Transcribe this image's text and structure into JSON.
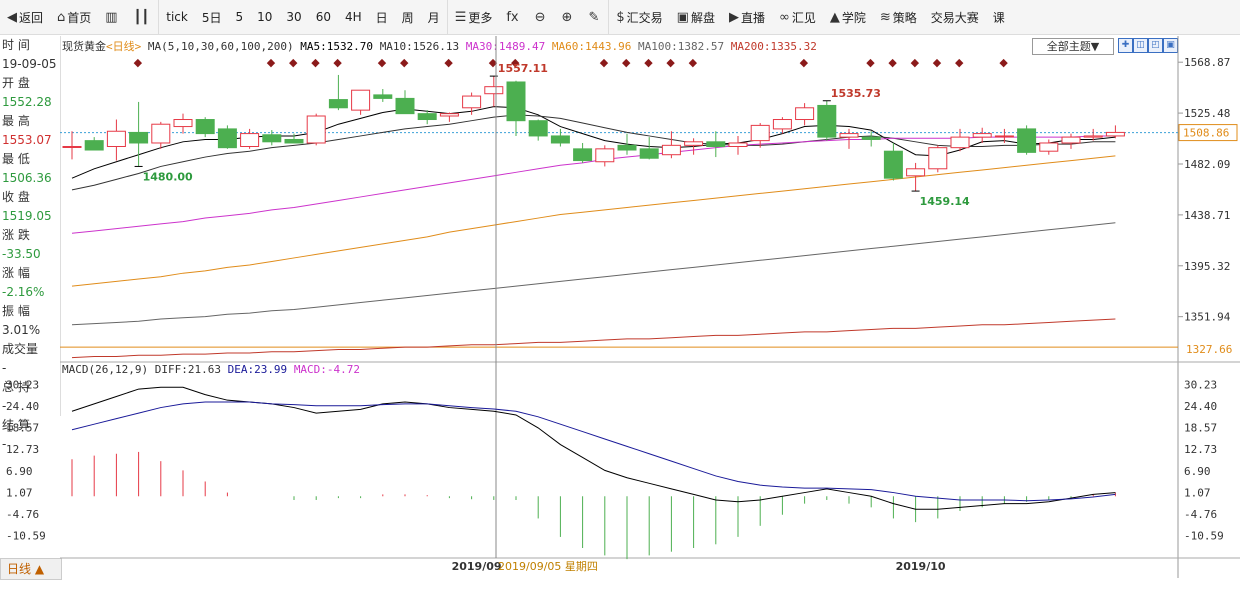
{
  "toolbar": {
    "items": [
      {
        "name": "back",
        "icon": "back-arrow-icon",
        "glyph": "◀",
        "label": "返回"
      },
      {
        "name": "home",
        "icon": "home-icon",
        "glyph": "⌂",
        "label": "首页"
      },
      {
        "name": "chart-type",
        "icon": "bar-chart-icon",
        "glyph": "▥",
        "label": ""
      },
      {
        "name": "candle",
        "icon": "candle-icon",
        "glyph": "┃┃",
        "label": ""
      },
      {
        "name": "tick",
        "icon": "",
        "glyph": "",
        "label": "tick"
      },
      {
        "name": "5day",
        "icon": "",
        "glyph": "",
        "label": "5日"
      },
      {
        "name": "p5",
        "icon": "",
        "glyph": "",
        "label": "5"
      },
      {
        "name": "p10",
        "icon": "",
        "glyph": "",
        "label": "10"
      },
      {
        "name": "p30",
        "icon": "",
        "glyph": "",
        "label": "30"
      },
      {
        "name": "p60",
        "icon": "",
        "glyph": "",
        "label": "60"
      },
      {
        "name": "p4h",
        "icon": "",
        "glyph": "",
        "label": "4H"
      },
      {
        "name": "day",
        "icon": "",
        "glyph": "",
        "label": "日"
      },
      {
        "name": "week",
        "icon": "",
        "glyph": "",
        "label": "周"
      },
      {
        "name": "month",
        "icon": "",
        "glyph": "",
        "label": "月"
      },
      {
        "name": "more",
        "icon": "list-icon",
        "glyph": "☰",
        "label": "更多"
      },
      {
        "name": "fx",
        "icon": "fx-icon",
        "glyph": "fx",
        "label": ""
      },
      {
        "name": "zoom-out",
        "icon": "zoom-out-icon",
        "glyph": "⊖",
        "label": ""
      },
      {
        "name": "zoom-in",
        "icon": "zoom-in-icon",
        "glyph": "⊕",
        "label": ""
      },
      {
        "name": "draw",
        "icon": "pen-icon",
        "glyph": "✎",
        "label": ""
      },
      {
        "name": "trade",
        "icon": "dollar-icon",
        "glyph": "$",
        "label": "汇交易"
      },
      {
        "name": "analysis",
        "icon": "chat-icon",
        "glyph": "▣",
        "label": "解盘"
      },
      {
        "name": "live",
        "icon": "play-icon",
        "glyph": "▶",
        "label": "直播"
      },
      {
        "name": "huijian",
        "icon": "link-icon",
        "glyph": "∞",
        "label": "汇见"
      },
      {
        "name": "academy",
        "icon": "graduation-cap-icon",
        "glyph": "▲",
        "label": "学院"
      },
      {
        "name": "strategy",
        "icon": "layers-icon",
        "glyph": "≋",
        "label": "策略"
      },
      {
        "name": "contest",
        "icon": "",
        "glyph": "",
        "label": "交易大赛"
      },
      {
        "name": "course",
        "icon": "",
        "glyph": "",
        "label": "课"
      }
    ]
  },
  "sidebar": {
    "rows": [
      {
        "label": "时 间",
        "cls": ""
      },
      {
        "label": "19-09-05",
        "cls": ""
      },
      {
        "label": "开 盘",
        "cls": ""
      },
      {
        "label": "1552.28",
        "cls": "sb-green"
      },
      {
        "label": "最 高",
        "cls": ""
      },
      {
        "label": "1553.07",
        "cls": "sb-red"
      },
      {
        "label": "最 低",
        "cls": ""
      },
      {
        "label": "1506.36",
        "cls": "sb-green"
      },
      {
        "label": "收 盘",
        "cls": ""
      },
      {
        "label": "1519.05",
        "cls": "sb-green"
      },
      {
        "label": "涨 跌",
        "cls": ""
      },
      {
        "label": "-33.50",
        "cls": "sb-green"
      },
      {
        "label": "涨 幅",
        "cls": ""
      },
      {
        "label": "-2.16%",
        "cls": "sb-green"
      },
      {
        "label": "振 幅",
        "cls": ""
      },
      {
        "label": "3.01%",
        "cls": ""
      },
      {
        "label": "成交量",
        "cls": ""
      },
      {
        "label": "-",
        "cls": ""
      },
      {
        "label": "总 持",
        "cls": ""
      },
      {
        "label": "-",
        "cls": ""
      },
      {
        "label": "结 算",
        "cls": ""
      },
      {
        "label": "-",
        "cls": ""
      }
    ],
    "bottom_tab": "日线 ▲"
  },
  "legend": {
    "instrument": "现货黄金",
    "period": "<日线>",
    "ma_spec": "MA(5,10,30,60,100,200)",
    "ma5": "MA5:1532.70",
    "ma10": "MA10:1526.13",
    "ma30": "MA30:1489.47",
    "ma60": "MA60:1443.96",
    "ma100": "MA100:1382.57",
    "ma200": "MA200:1335.32",
    "theme_button": "全部主题▼"
  },
  "macd_legend": {
    "spec": "MACD(26,12,9)",
    "diff": "DIFF:21.63",
    "dea": "DEA:23.99",
    "macd": "MACD:-4.72"
  },
  "colors": {
    "up": "#e63946",
    "down": "#4caf50",
    "ma5": "#000000",
    "ma10": "#333333",
    "ma30": "#cc33cc",
    "ma60": "#e08c1a",
    "ma100": "#666666",
    "ma200": "#c0392b",
    "diff": "#000000",
    "dea": "#1a1a99"
  },
  "chart_data": [
    {
      "type": "candlestick",
      "title": "现货黄金<日线>",
      "ylim": [
        1315,
        1575
      ],
      "yticks": [
        1568.87,
        1525.48,
        1482.09,
        1438.71,
        1395.32,
        1351.94
      ],
      "current_price_label": "1508.86",
      "bottom_price_label": "1327.66",
      "candles": [
        {
          "o": 1497,
          "h": 1510,
          "l": 1486,
          "c": 1497
        },
        {
          "o": 1502,
          "h": 1505,
          "l": 1495,
          "c": 1494
        },
        {
          "o": 1497,
          "h": 1520,
          "l": 1485,
          "c": 1510
        },
        {
          "o": 1509,
          "h": 1535,
          "l": 1480,
          "c": 1500
        },
        {
          "o": 1500,
          "h": 1518,
          "l": 1495,
          "c": 1516
        },
        {
          "o": 1514,
          "h": 1525,
          "l": 1508,
          "c": 1520
        },
        {
          "o": 1520,
          "h": 1522,
          "l": 1505,
          "c": 1508
        },
        {
          "o": 1512,
          "h": 1515,
          "l": 1495,
          "c": 1496
        },
        {
          "o": 1497,
          "h": 1512,
          "l": 1495,
          "c": 1508
        },
        {
          "o": 1507,
          "h": 1511,
          "l": 1498,
          "c": 1501
        },
        {
          "o": 1503,
          "h": 1508,
          "l": 1500,
          "c": 1500
        },
        {
          "o": 1500,
          "h": 1525,
          "l": 1498,
          "c": 1523
        },
        {
          "o": 1537,
          "h": 1558,
          "l": 1528,
          "c": 1530
        },
        {
          "o": 1528,
          "h": 1545,
          "l": 1524,
          "c": 1545
        },
        {
          "o": 1541,
          "h": 1546,
          "l": 1535,
          "c": 1538
        },
        {
          "o": 1538,
          "h": 1545,
          "l": 1525,
          "c": 1525
        },
        {
          "o": 1525,
          "h": 1528,
          "l": 1516,
          "c": 1520
        },
        {
          "o": 1523,
          "h": 1526,
          "l": 1518,
          "c": 1525
        },
        {
          "o": 1530,
          "h": 1543,
          "l": 1524,
          "c": 1540
        },
        {
          "o": 1542,
          "h": 1557,
          "l": 1531,
          "c": 1548
        },
        {
          "o": 1552,
          "h": 1553,
          "l": 1506,
          "c": 1519
        },
        {
          "o": 1519,
          "h": 1520,
          "l": 1502,
          "c": 1506
        },
        {
          "o": 1506,
          "h": 1512,
          "l": 1497,
          "c": 1500
        },
        {
          "o": 1495,
          "h": 1500,
          "l": 1483,
          "c": 1485
        },
        {
          "o": 1484,
          "h": 1498,
          "l": 1480,
          "c": 1495
        },
        {
          "o": 1498,
          "h": 1508,
          "l": 1490,
          "c": 1494
        },
        {
          "o": 1495,
          "h": 1505,
          "l": 1486,
          "c": 1487
        },
        {
          "o": 1490,
          "h": 1510,
          "l": 1487,
          "c": 1498
        },
        {
          "o": 1498,
          "h": 1504,
          "l": 1490,
          "c": 1501
        },
        {
          "o": 1501,
          "h": 1510,
          "l": 1488,
          "c": 1497
        },
        {
          "o": 1497,
          "h": 1506,
          "l": 1490,
          "c": 1500
        },
        {
          "o": 1502,
          "h": 1517,
          "l": 1496,
          "c": 1515
        },
        {
          "o": 1512,
          "h": 1522,
          "l": 1508,
          "c": 1520
        },
        {
          "o": 1520,
          "h": 1534,
          "l": 1515,
          "c": 1530
        },
        {
          "o": 1532,
          "h": 1536,
          "l": 1502,
          "c": 1505
        },
        {
          "o": 1505,
          "h": 1512,
          "l": 1495,
          "c": 1508
        },
        {
          "o": 1505,
          "h": 1510,
          "l": 1497,
          "c": 1503
        },
        {
          "o": 1493,
          "h": 1500,
          "l": 1468,
          "c": 1470
        },
        {
          "o": 1472,
          "h": 1483,
          "l": 1459,
          "c": 1478
        },
        {
          "o": 1478,
          "h": 1498,
          "l": 1475,
          "c": 1496
        },
        {
          "o": 1496,
          "h": 1512,
          "l": 1493,
          "c": 1505
        },
        {
          "o": 1505,
          "h": 1513,
          "l": 1500,
          "c": 1508
        },
        {
          "o": 1506,
          "h": 1512,
          "l": 1500,
          "c": 1506
        },
        {
          "o": 1512,
          "h": 1515,
          "l": 1490,
          "c": 1492
        },
        {
          "o": 1493,
          "h": 1503,
          "l": 1490,
          "c": 1500
        },
        {
          "o": 1500,
          "h": 1508,
          "l": 1495,
          "c": 1505
        },
        {
          "o": 1505,
          "h": 1512,
          "l": 1502,
          "c": 1506
        },
        {
          "o": 1506,
          "h": 1515,
          "l": 1504,
          "c": 1509
        }
      ],
      "annotations": [
        {
          "label": "1480.00",
          "candle": 3,
          "value": 1480
        },
        {
          "label": "1557.11",
          "candle": 19,
          "value": 1557
        },
        {
          "label": "1535.73",
          "candle": 34,
          "value": 1536
        },
        {
          "label": "1459.14",
          "candle": 38,
          "value": 1459
        }
      ],
      "event_markers": [
        3,
        9,
        10,
        11,
        12,
        14,
        15,
        17,
        19,
        20,
        24,
        25,
        26,
        27,
        28,
        33,
        36,
        37,
        38,
        39,
        40,
        42
      ],
      "ma": {
        "ma5": {
          "v": [
            1470,
            1478,
            1484,
            1490,
            1496,
            1501,
            1503,
            1503,
            1505,
            1506,
            1506,
            1509,
            1516,
            1521,
            1526,
            1529,
            1527,
            1525,
            1527,
            1531,
            1530,
            1524,
            1514,
            1508,
            1502,
            1499,
            1497,
            1496,
            1497,
            1499,
            1500,
            1503,
            1508,
            1514,
            1515,
            1514,
            1511,
            1500,
            1490,
            1489,
            1494,
            1501,
            1502,
            1499,
            1500,
            1503,
            1503,
            1505
          ]
        },
        "ma10": {
          "v": [
            1460,
            1464,
            1469,
            1474,
            1480,
            1484,
            1488,
            1491,
            1493,
            1496,
            1498,
            1500,
            1503,
            1506,
            1509,
            1512,
            1514,
            1516,
            1519,
            1522,
            1524,
            1523,
            1521,
            1517,
            1513,
            1509,
            1506,
            1503,
            1500,
            1499,
            1498,
            1498,
            1499,
            1501,
            1503,
            1505,
            1506,
            1504,
            1501,
            1498,
            1497,
            1497,
            1498,
            1498,
            1499,
            1499,
            1501,
            1501
          ]
        },
        "ma30": {
          "v": [
            1423,
            1425,
            1427,
            1429,
            1431,
            1433,
            1436,
            1438,
            1440,
            1443,
            1445,
            1448,
            1451,
            1454,
            1457,
            1460,
            1463,
            1466,
            1469,
            1472,
            1475,
            1478,
            1481,
            1483,
            1486,
            1488,
            1490,
            1492,
            1494,
            1496,
            1498,
            1499,
            1500,
            1501,
            1502,
            1503,
            1503,
            1504,
            1504,
            1504,
            1504,
            1505,
            1505,
            1505,
            1505,
            1505,
            1506,
            1506
          ]
        },
        "ma60": {
          "v": [
            1378,
            1380,
            1382,
            1384,
            1386,
            1389,
            1391,
            1394,
            1396,
            1399,
            1402,
            1405,
            1408,
            1411,
            1414,
            1417,
            1420,
            1424,
            1427,
            1430,
            1433,
            1436,
            1439,
            1441,
            1443,
            1445,
            1447,
            1449,
            1451,
            1453,
            1455,
            1457,
            1459,
            1461,
            1463,
            1465,
            1467,
            1469,
            1471,
            1473,
            1475,
            1477,
            1479,
            1481,
            1483,
            1485,
            1487,
            1489
          ]
        },
        "ma100": {
          "v": [
            1345,
            1346,
            1347,
            1348,
            1350,
            1351,
            1352,
            1354,
            1355,
            1357,
            1358,
            1360,
            1362,
            1364,
            1366,
            1368,
            1370,
            1372,
            1374,
            1376,
            1378,
            1380,
            1382,
            1384,
            1386,
            1388,
            1390,
            1392,
            1394,
            1396,
            1398,
            1400,
            1402,
            1404,
            1406,
            1408,
            1410,
            1412,
            1414,
            1416,
            1418,
            1420,
            1422,
            1424,
            1426,
            1428,
            1430,
            1432
          ]
        },
        "ma200": {
          "v": [
            1317,
            1318,
            1318,
            1319,
            1319,
            1320,
            1320,
            1321,
            1321,
            1322,
            1322,
            1323,
            1324,
            1324,
            1325,
            1326,
            1326,
            1327,
            1328,
            1328,
            1329,
            1330,
            1330,
            1331,
            1332,
            1333,
            1333,
            1334,
            1335,
            1336,
            1336,
            1337,
            1338,
            1339,
            1339,
            1340,
            1341,
            1342,
            1342,
            1343,
            1344,
            1345,
            1345,
            1346,
            1347,
            1348,
            1349,
            1350
          ]
        }
      }
    },
    {
      "type": "macd",
      "title": "MACD(26,12,9)",
      "ylim": [
        -14,
        32
      ],
      "yticks": [
        30.23,
        24.4,
        18.57,
        12.73,
        6.9,
        1.07,
        -4.76,
        -10.59
      ],
      "diff": [
        23,
        25,
        27,
        29,
        29.5,
        29.5,
        27.5,
        26,
        25.5,
        25,
        24,
        22.5,
        23,
        23.5,
        25,
        25.5,
        25,
        24,
        23.5,
        23,
        22,
        18.5,
        14,
        10.5,
        7,
        5,
        3.5,
        2,
        0.5,
        -1,
        -1.5,
        -1,
        0,
        1,
        2,
        1,
        0,
        -2,
        -3.5,
        -3.5,
        -3,
        -2.5,
        -2,
        -2,
        -1.5,
        -0.5,
        0.5,
        1
      ],
      "dea": [
        18,
        19.5,
        21,
        22.5,
        24,
        25,
        25.5,
        25.5,
        25.5,
        25,
        24.8,
        24.5,
        24.5,
        24.5,
        24.8,
        25,
        25,
        24.5,
        24,
        23.6,
        23,
        21.5,
        19.5,
        17.5,
        15.5,
        13.5,
        11.5,
        9.5,
        7.5,
        5.5,
        4,
        3,
        2.5,
        2.2,
        2.2,
        2,
        1.8,
        1,
        0,
        -0.5,
        -1,
        -1,
        -1,
        -1.2,
        -1,
        -0.7,
        -0.2,
        0.5
      ],
      "histogram": [
        10,
        11,
        11.5,
        12,
        9.5,
        7,
        4,
        1,
        0,
        0,
        -1,
        -1,
        -0.5,
        -0.5,
        0.5,
        0.5,
        0.3,
        -0.5,
        -0.8,
        -1,
        -1,
        -6,
        -11,
        -14,
        -16,
        -17,
        -16,
        -15,
        -14,
        -13,
        -11,
        -8,
        -5,
        -2,
        -1,
        -2,
        -3,
        -6,
        -7,
        -6,
        -4,
        -3,
        -2,
        -1.5,
        -1,
        -0.5,
        0.5,
        1
      ],
      "x_labels": [
        {
          "candle": 18,
          "label": "2019/09"
        },
        {
          "candle": 38,
          "label": "2019/10"
        }
      ],
      "crosshair_label": "2019/09/05  星期四",
      "crosshair_candle": 20
    }
  ]
}
